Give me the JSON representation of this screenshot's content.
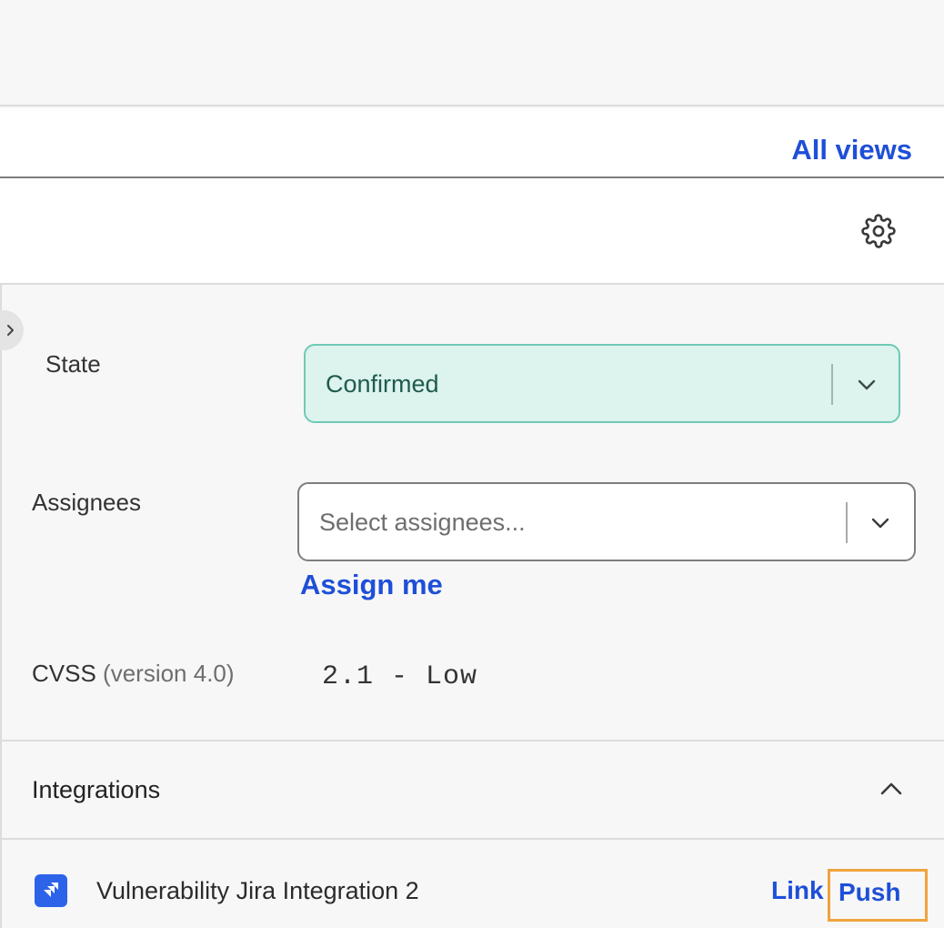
{
  "header": {
    "all_views_label": "All views"
  },
  "toolbar": {
    "settings_icon": "gear-icon"
  },
  "sidebar": {
    "state": {
      "label": "State",
      "value": "Confirmed",
      "accent_bg": "#dcf3ee",
      "accent_border": "#6fcab5"
    },
    "assignees": {
      "label": "Assignees",
      "placeholder": "Select assignees...",
      "assign_me_label": "Assign me"
    },
    "cvss": {
      "label": "CVSS",
      "version_label": "(version 4.0)",
      "value": "2.1 - Low"
    },
    "integrations": {
      "title": "Integrations",
      "items": [
        {
          "name": "Vulnerability Jira Integration 2",
          "icon": "jira-icon",
          "link_label": "Link",
          "push_label": "Push"
        }
      ]
    }
  },
  "colors": {
    "link": "#1f4fd8",
    "highlight": "#f0a33c"
  }
}
